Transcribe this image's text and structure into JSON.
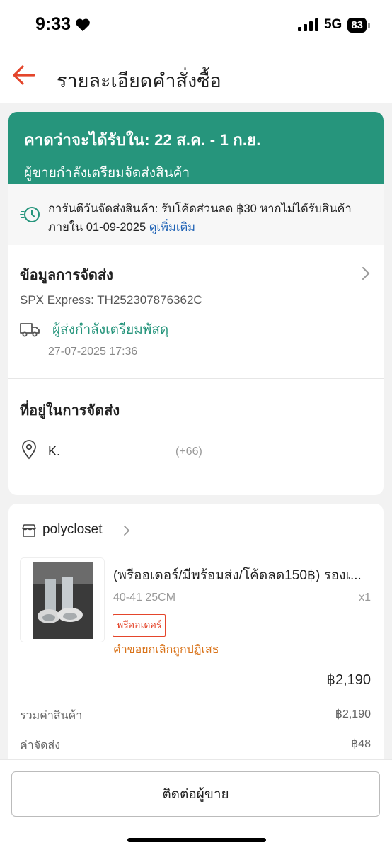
{
  "status_bar": {
    "time": "9:33",
    "network": "5G",
    "battery": "83"
  },
  "header": {
    "title": "รายละเอียดคำสั่งซื้อ"
  },
  "delivery": {
    "estimate_title": "คาดว่าจะได้รับใน: 22 ส.ค. - 1 ก.ย.",
    "estimate_sub": "ผู้ขายกำลังเตรียมจัดส่งสินค้า",
    "guarantee_line1": "การันตีวันจัดส่งสินค้า: รับโค้ดส่วนลด ฿30 หากไม่ได้รับสินค้า",
    "guarantee_line2": "ภายใน 01-09-2025 ",
    "guarantee_link": "ดูเพิ่มเติม"
  },
  "shipping": {
    "title": "ข้อมูลการจัดส่ง",
    "tracking": "SPX Express: TH252307876362C",
    "status": "ผู้ส่งกำลังเตรียมพัสดุ",
    "timestamp": "27-07-2025 17:36"
  },
  "address": {
    "title": "ที่อยู่ในการจัดส่ง",
    "name": "K.",
    "phone": "(+66)"
  },
  "shop": {
    "name": "polycloset"
  },
  "product": {
    "title": "(พรีออเดอร์/มีพร้อมส่ง/โค้ดลด150฿) รองเ...",
    "variant": "40-41 25CM",
    "quantity": "x1",
    "badge": "พรีออเดอร์",
    "cancel_status": "คำขอยกเลิกถูกปฏิเสธ",
    "price": "฿2,190"
  },
  "totals": [
    {
      "label": "รวมค่าสินค้า",
      "value": "฿2,190"
    },
    {
      "label": "ค่าจัดส่ง",
      "value": "฿48"
    }
  ],
  "actions": {
    "contact_seller": "ติดต่อผู้ขาย"
  },
  "colors": {
    "accent_green": "#26957c",
    "brand_orange": "#e4452b",
    "link_blue": "#1a5fb4",
    "warning_orange": "#d9731a"
  }
}
